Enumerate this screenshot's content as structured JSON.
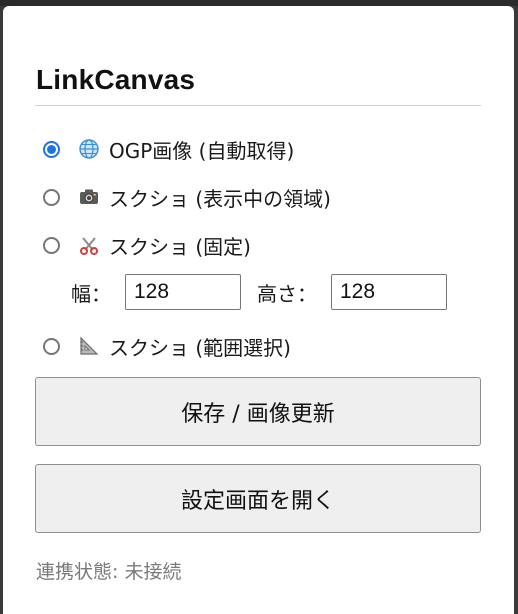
{
  "app": {
    "title": "LinkCanvas"
  },
  "options": [
    {
      "icon": "globe-icon",
      "label": "OGP画像 (自動取得)",
      "checked": true
    },
    {
      "icon": "camera-icon",
      "label": "スクショ (表示中の領域)",
      "checked": false
    },
    {
      "icon": "scissors-icon",
      "label": "スクショ (固定)",
      "checked": false
    },
    {
      "icon": "triangle-ruler-icon",
      "label": "スクショ (範囲選択)",
      "checked": false
    }
  ],
  "fixed_size": {
    "width_label": "幅：",
    "width_value": "128",
    "height_label": "高さ：",
    "height_value": "128"
  },
  "buttons": {
    "save_label": "保存 / 画像更新",
    "settings_label": "設定画面を開く"
  },
  "status": {
    "text": "連携状態: 未接続"
  },
  "colors": {
    "accent": "#1a73e8",
    "button_bg": "#efefef",
    "status_text": "#7a7a7a"
  }
}
